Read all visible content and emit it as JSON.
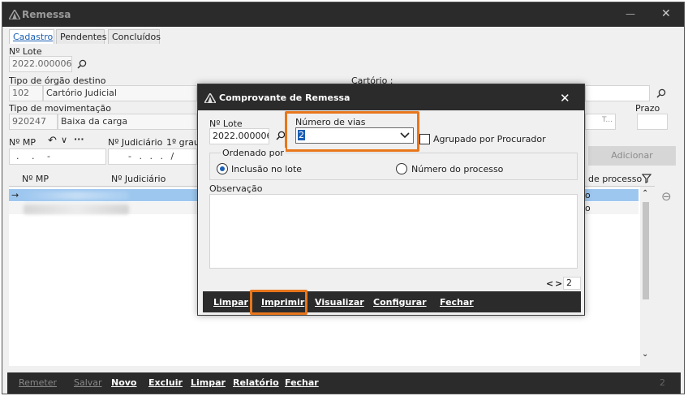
{
  "window": {
    "title": "Remessa",
    "minimize_label": "—",
    "close_label": "✕"
  },
  "tabs": [
    "Cadastro",
    "Pendentes",
    "Concluídos"
  ],
  "form": {
    "lote_label": "Nº Lote",
    "lote_value": "2022.000006",
    "orgao_label": "Tipo de órgão destino",
    "orgao_code": "102",
    "orgao_name": "Cartório Judicial",
    "cartorio_label": "Cartório :",
    "mov_label": "Tipo de movimentação",
    "mov_code": "920247",
    "mov_name": "Baixa da carga",
    "prazo_label": "Prazo",
    "t_hint": "T...",
    "mp_label": "Nº MP",
    "judicial_label": "Nº Judiciário",
    "grau_label": "1º grau",
    "mp_mask": ". . -",
    "judicial_mask": "- . . . /",
    "adicionar_label": "Adicionar",
    "undo_glyph": "↶",
    "chevron_glyph": "∨",
    "more_glyph": "···"
  },
  "grid": {
    "col_mp": "Nº MP",
    "col_judicial": "Nº Judiciário",
    "col_processo": "de processo",
    "row_arrow": "→",
    "rows": [
      {
        "processo": "o",
        "selected": true
      },
      {
        "processo": "o",
        "selected": false
      }
    ],
    "scroll_up": "⌃",
    "scroll_down": "⌄",
    "remove_glyph": "⊖"
  },
  "bottom": {
    "buttons": [
      {
        "label": "Remeter",
        "enabled": false
      },
      {
        "label": "Salvar",
        "enabled": false
      },
      {
        "label": "Novo",
        "enabled": true
      },
      {
        "label": "Excluir",
        "enabled": true
      },
      {
        "label": "Limpar",
        "enabled": true
      },
      {
        "label": "Relatório",
        "enabled": true
      },
      {
        "label": "Fechar",
        "enabled": true
      }
    ],
    "page_indicator": "2"
  },
  "dialog": {
    "title": "Comprovante de Remessa",
    "close_label": "✕",
    "lote_label": "Nº Lote",
    "lote_value": "2022.000006",
    "vias_label": "Número de vias",
    "vias_value": "2",
    "agrupado_label": "Agrupado por Procurador",
    "agrupado_checked": false,
    "ordenado_label": "Ordenado por",
    "opt_lote": "Inclusão no lote",
    "opt_processo": "Número do processo",
    "selected_option": "Inclusão no lote",
    "obs_label": "Observação",
    "obs_value": "",
    "counter_prev": "<",
    "counter_next": ">",
    "counter_value": "2",
    "buttons": [
      "Limpar",
      "Imprimir",
      "Visualizar",
      "Configurar",
      "Fechar"
    ],
    "highlight_color": "#e8761b"
  }
}
